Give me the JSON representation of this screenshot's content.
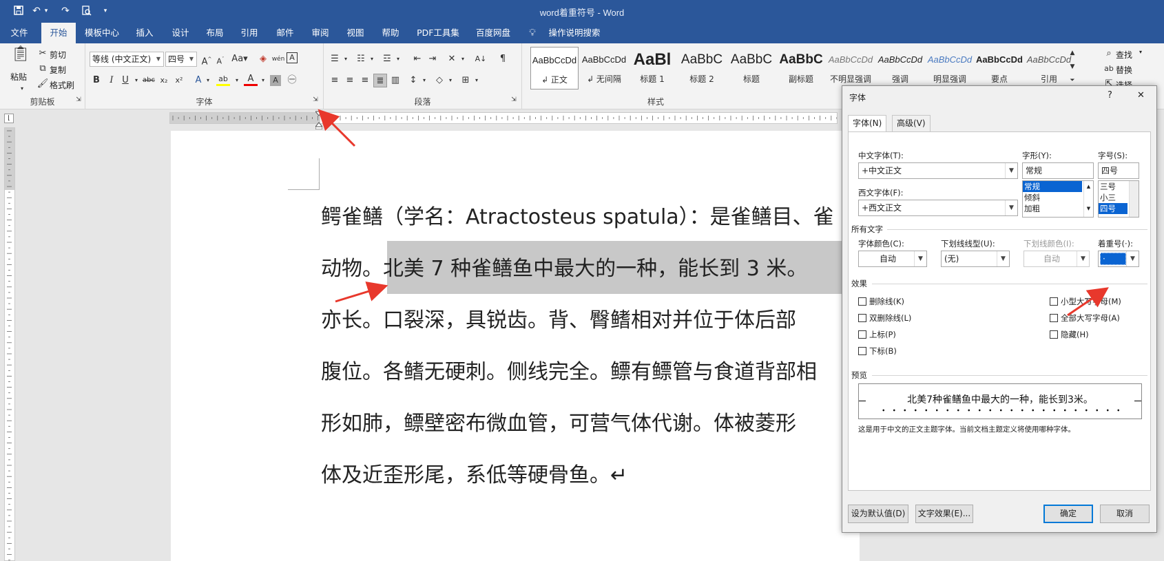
{
  "window": {
    "title": "word着重符号 - Word"
  },
  "quick_access": {
    "save_icon": "save-icon",
    "undo_icon": "undo-icon",
    "redo_icon": "redo-icon",
    "preview_icon": "print-preview-icon"
  },
  "menu_tabs": [
    {
      "label": "文件"
    },
    {
      "label": "开始"
    },
    {
      "label": "模板中心"
    },
    {
      "label": "插入"
    },
    {
      "label": "设计"
    },
    {
      "label": "布局"
    },
    {
      "label": "引用"
    },
    {
      "label": "邮件"
    },
    {
      "label": "审阅"
    },
    {
      "label": "视图"
    },
    {
      "label": "帮助"
    },
    {
      "label": "PDF工具集"
    },
    {
      "label": "百度网盘"
    },
    {
      "label": "操作说明搜索"
    }
  ],
  "ribbon": {
    "clipboard": {
      "paste": "粘贴",
      "cut": "剪切",
      "copy": "复制",
      "format_painter": "格式刷",
      "label": "剪贴板"
    },
    "font": {
      "font_name": "等线 (中文正文)",
      "font_size": "四号",
      "label": "字体"
    },
    "paragraph": {
      "label": "段落"
    },
    "styles": {
      "label": "样式",
      "items": [
        {
          "preview": "AaBbCcDd",
          "name": "↲ 正文"
        },
        {
          "preview": "AaBbCcDd",
          "name": "↲ 无间隔"
        },
        {
          "preview": "AaBl",
          "name": "标题 1"
        },
        {
          "preview": "AaBbC",
          "name": "标题 2"
        },
        {
          "preview": "AaBbC",
          "name": "标题"
        },
        {
          "preview": "AaBbC",
          "name": "副标题"
        },
        {
          "preview": "AaBbCcDd",
          "name": "不明显强调"
        },
        {
          "preview": "AaBbCcDd",
          "name": "强调"
        },
        {
          "preview": "AaBbCcDd",
          "name": "明显强调"
        },
        {
          "preview": "AaBbCcDd",
          "name": "要点"
        },
        {
          "preview": "AaBbCcDd",
          "name": "引用"
        }
      ]
    },
    "editing": {
      "find": "查找",
      "replace": "替换",
      "select": "选择"
    }
  },
  "document": {
    "lines": [
      "鳄雀鳝（学名：Atractosteus spatula）：是雀鳝目、雀",
      "动物。北美 7 种雀鳝鱼中最大的一种，能长到 3 米。",
      "亦长。口裂深，具锐齿。背、臀鳍相对并位于体后部",
      "腹位。各鳍无硬刺。侧线完全。鳔有鳔管与食道背部相",
      "形如肺，鳔壁密布微血管，可营气体代谢。体被菱形",
      "体及近歪形尾，系低等硬骨鱼。↵"
    ]
  },
  "dialog": {
    "title": "字体",
    "help": "?",
    "close": "✕",
    "tabs": [
      "字体(N)",
      "高级(V)"
    ],
    "cn_font_label": "中文字体(T):",
    "cn_font_value": "+中文正文",
    "west_font_label": "西文字体(F):",
    "west_font_value": "+西文正文",
    "style_label": "字形(Y):",
    "style_value": "常规",
    "style_options": [
      "常规",
      "倾斜",
      "加粗"
    ],
    "size_label": "字号(S):",
    "size_value": "四号",
    "size_options": [
      "三号",
      "小三",
      "四号"
    ],
    "all_text_label": "所有文字",
    "font_color_label": "字体颜色(C):",
    "font_color_value": "自动",
    "underline_label": "下划线线型(U):",
    "underline_value": "(无)",
    "underline_color_label": "下划线颜色(I):",
    "underline_color_value": "自动",
    "emphasis_label": "着重号(·):",
    "emphasis_value": "·",
    "effects_label": "效果",
    "effects_left": [
      "删除线(K)",
      "双删除线(L)",
      "上标(P)",
      "下标(B)"
    ],
    "effects_right": [
      "小型大写字母(M)",
      "全部大写字母(A)",
      "隐藏(H)"
    ],
    "preview_label": "预览",
    "preview_text": "北美7种雀鳝鱼中最大的一种，能长到3米。",
    "preview_note": "这是用于中文的正文主题字体。当前文档主题定义将使用哪种字体。",
    "buttons": {
      "default": "设为默认值(D)",
      "effects": "文字效果(E)...",
      "ok": "确定",
      "cancel": "取消"
    }
  },
  "colors": {
    "brand": "#2b579a",
    "selection": "#c8c8c8",
    "list_selected": "#0a64d2",
    "arrow": "#e8382c"
  }
}
